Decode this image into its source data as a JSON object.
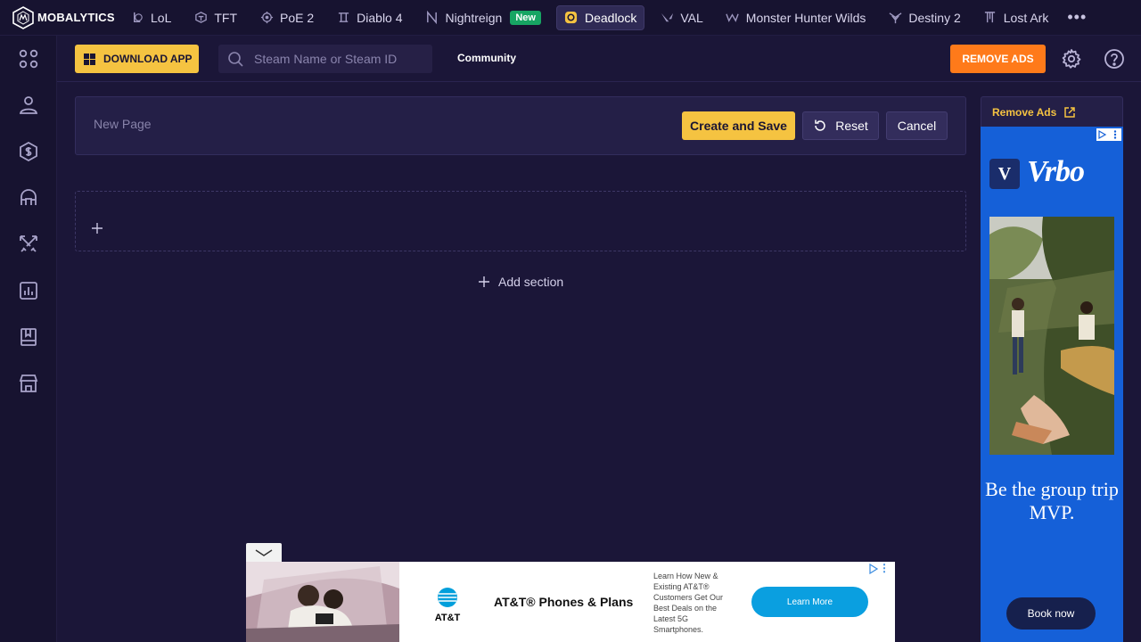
{
  "brand": {
    "name": "MOBALYTICS"
  },
  "nav": {
    "games": [
      {
        "label": "LoL",
        "icon": "lol-icon"
      },
      {
        "label": "TFT",
        "icon": "tft-icon"
      },
      {
        "label": "PoE 2",
        "icon": "poe2-icon"
      },
      {
        "label": "Diablo 4",
        "icon": "diablo4-icon"
      },
      {
        "label": "Nightreign",
        "icon": "nightreign-icon",
        "badge": "New"
      },
      {
        "label": "Deadlock",
        "icon": "deadlock-icon",
        "active": true
      },
      {
        "label": "VAL",
        "icon": "valorant-icon"
      },
      {
        "label": "Monster Hunter Wilds",
        "icon": "monster-hunter-icon"
      },
      {
        "label": "Destiny 2",
        "icon": "destiny2-icon"
      },
      {
        "label": "Lost Ark",
        "icon": "lost-ark-icon"
      }
    ],
    "more_label": "•••"
  },
  "rail": {
    "items": [
      "grid-icon",
      "profile-icon",
      "dollar-shield-icon",
      "helmet-icon",
      "swords-icon",
      "stats-icon",
      "book-icon",
      "store-icon"
    ]
  },
  "header": {
    "download_label": "DOWNLOAD APP",
    "search_placeholder": "Steam Name or Steam ID",
    "community_label": "Community",
    "remove_ads_label": "REMOVE ADS"
  },
  "editor": {
    "page_name_placeholder": "New Page",
    "create_label": "Create and Save",
    "reset_label": "Reset",
    "cancel_label": "Cancel",
    "add_section_label": "Add section"
  },
  "side_ad": {
    "remove_ads_label": "Remove Ads",
    "brand_letter": "V",
    "brand": "Vrbo",
    "tagline": "Be the group trip MVP.",
    "cta": "Book now"
  },
  "bottom_ad": {
    "brand": "AT&T",
    "title": "AT&T® Phones & Plans",
    "body": "Learn How New & Existing AT&T® Customers Get Our Best Deals on the Latest 5G Smartphones.",
    "cta": "Learn More",
    "collapse_icon": "chevron-down-icon"
  },
  "colors": {
    "accent": "#f5c341",
    "remove_ads": "#ff7a1a",
    "background": "#1b1638",
    "nav_bg": "#171330",
    "new_badge": "#17a563"
  }
}
